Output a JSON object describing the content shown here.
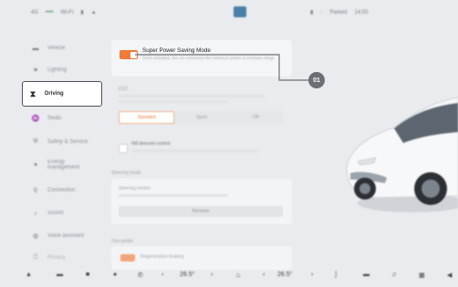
{
  "status_bar": {
    "left_items": [
      "4G",
      "••••",
      "Wi-Fi",
      "▮",
      "▲"
    ],
    "right_items": [
      "▮",
      "◦",
      "Parked",
      "14:00"
    ]
  },
  "sidebar": {
    "items": [
      {
        "icon": "car-icon",
        "glyph": "▬",
        "label": "Vehicle"
      },
      {
        "icon": "light-icon",
        "glyph": "✷",
        "label": "Lighting"
      },
      {
        "icon": "steering-icon",
        "glyph": "⧗",
        "label": "Driving",
        "active": true
      },
      {
        "icon": "seat-icon",
        "glyph": "♒",
        "label": "Seats"
      },
      {
        "icon": "shield-icon",
        "glyph": "⛨",
        "label": "Safety & Service"
      },
      {
        "icon": "energy-icon",
        "glyph": "✦",
        "label": "Energy management"
      },
      {
        "icon": "link-icon",
        "glyph": "⚲",
        "label": "Connection"
      },
      {
        "icon": "sound-icon",
        "glyph": "♪",
        "label": "Sound"
      },
      {
        "icon": "voice-icon",
        "glyph": "◍",
        "label": "Voice assistant"
      },
      {
        "icon": "privacy-icon",
        "glyph": "⚿",
        "label": "Privacy"
      }
    ]
  },
  "power_saving": {
    "title": "Super Power Saving Mode",
    "description": "Once activated, the car consumes the minimum power to increase range",
    "enabled": true
  },
  "drive_mode": {
    "section": "ESC",
    "hint": "The electronic stability control...",
    "options": [
      "Standard",
      "Sport",
      "Off"
    ],
    "selected": 0,
    "hill_title": "Hill descent control",
    "hill_desc": "..."
  },
  "steering": {
    "section": "Steering mode",
    "line1": "Steering modes",
    "button": "Rename"
  },
  "regen": {
    "section": "One-pedal",
    "label": "Regenerative braking"
  },
  "callout": {
    "label": "01"
  },
  "dock": {
    "left_temp": "26.5°",
    "right_temp": "26.5°",
    "left_arrow_l": "‹",
    "left_arrow_r": "›",
    "right_arrow_l": "‹",
    "right_arrow_r": "›"
  },
  "colors": {
    "accent": "#f07a3a",
    "callout": "#6b6f75",
    "active_border": "#4d5157"
  }
}
